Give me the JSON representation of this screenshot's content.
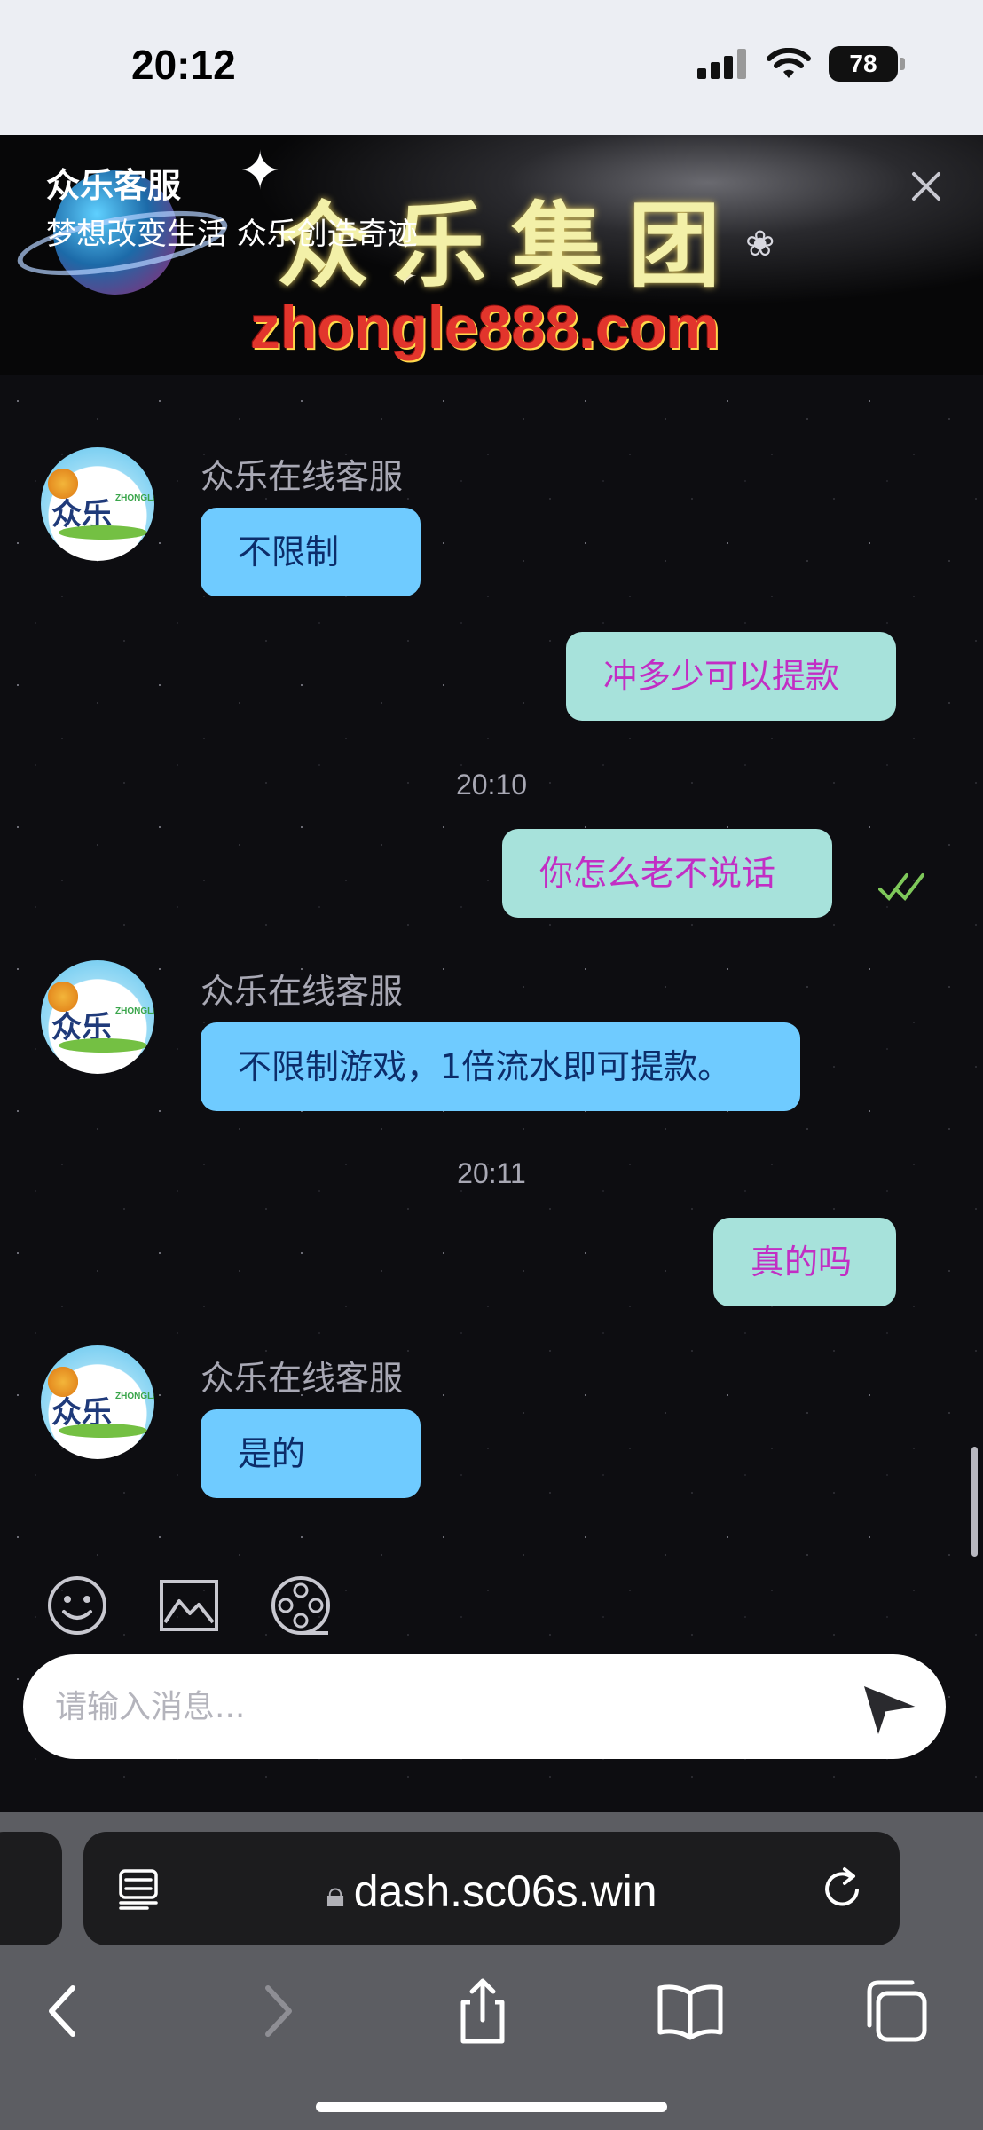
{
  "status_bar": {
    "time": "20:12",
    "battery": "78"
  },
  "header": {
    "title": "众乐客服",
    "subtitle": "梦想改变生活 众乐创造奇迹",
    "banner_brand": "众乐集团",
    "banner_url": "zhongle888.com"
  },
  "avatar": {
    "text": "众乐",
    "tag": "ZHONGLE"
  },
  "messages": [
    {
      "sender": "众乐在线客服",
      "text": "不限制"
    },
    {
      "text": "冲多少可以提款"
    },
    {
      "timestamp": "20:10"
    },
    {
      "text": "你怎么老不说话"
    },
    {
      "sender": "众乐在线客服",
      "text": "不限制游戏，1倍流水即可提款。"
    },
    {
      "timestamp": "20:11"
    },
    {
      "text": "真的吗"
    },
    {
      "sender": "众乐在线客服",
      "text": "是的"
    }
  ],
  "input": {
    "placeholder": "请输入消息..."
  },
  "tools": [
    "emoji-icon",
    "image-icon",
    "video-icon"
  ],
  "browser": {
    "url": "dash.sc06s.win"
  },
  "colors": {
    "incoming_bubble": "#6fcbff",
    "outgoing_bubble": "#a7e2db",
    "outgoing_text": "#c22ec4",
    "incoming_text": "#0c2d6a"
  }
}
